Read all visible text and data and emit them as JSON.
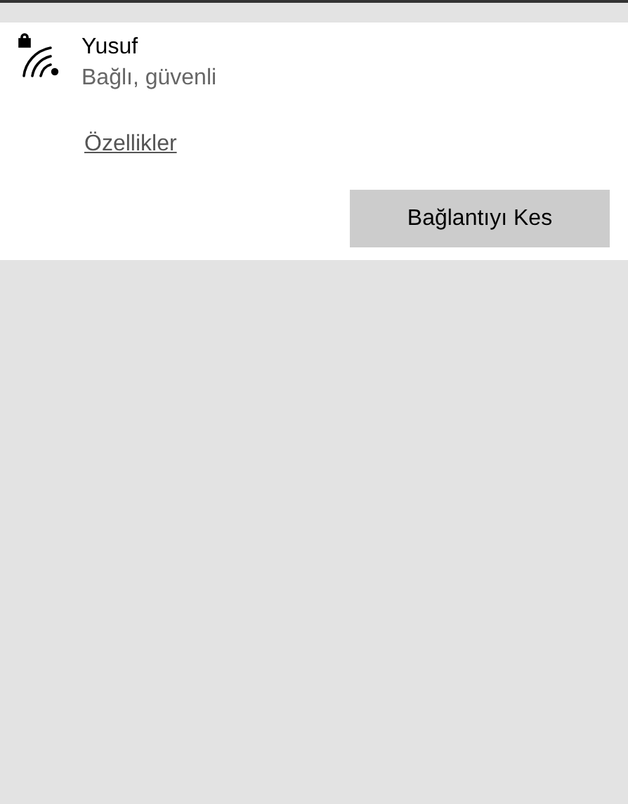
{
  "network": {
    "name": "Yusuf",
    "status": "Bağlı, güvenli",
    "secured": true
  },
  "properties_link": "Özellikler",
  "disconnect_button": "Bağlantıyı Kes"
}
